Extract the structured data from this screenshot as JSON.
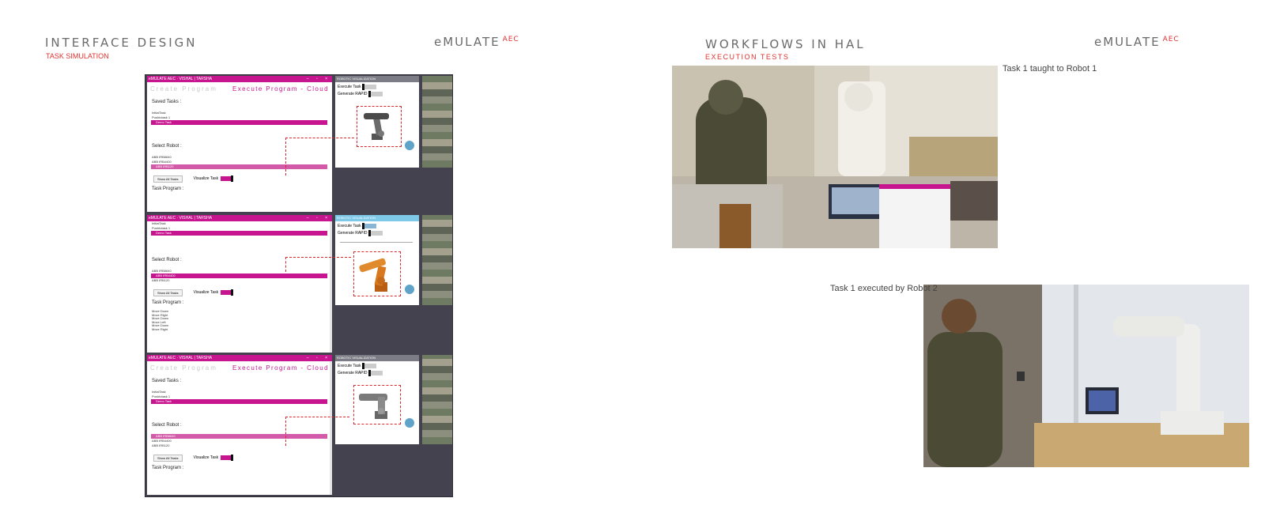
{
  "left_page": {
    "title": "INTERFACE DESIGN",
    "subtitle": "TASK SIMULATION",
    "brand": "eMULATE",
    "brand_sup": "AEC"
  },
  "right_page": {
    "title": "WORKFLOWS IN HAL",
    "subtitle": "EXECUTION TESTS",
    "brand": "eMULATE",
    "brand_sup": "AEC",
    "caption_top": "Task 1 taught to Robot 1",
    "caption_bottom": "Task 1 executed by Robot 2"
  },
  "composite": {
    "window_title": "eMULATE AEC · VISHAL | TARSHA",
    "viz_title": "ROBOTIC VISUALIZATION",
    "tab_create": "Create Program",
    "tab_execute": "Execute Program - Cloud",
    "saved_tasks_label": "Saved Tasks :",
    "select_robot_label": "Select Robot :",
    "task_program_label": "Task Program :",
    "show_all_tasks": "Show All Tasks",
    "visualize_task": "Visualize Task",
    "execute_task": "Execute Task",
    "generate_rapid": "Generate RAPID",
    "tasks": [
      "InitialTask",
      "Pushtotask 1",
      "Demo Task"
    ],
    "robots": [
      "ABB IRB6640",
      "ABB IRB4400",
      "ABB IRB120"
    ],
    "program_lines": [
      "Move Down",
      "Move Right",
      "Move Down",
      "Move Left",
      "Move Down",
      "Move Right",
      "Move Down"
    ]
  },
  "colors": {
    "accent": "#c7158f",
    "red": "#e0312f",
    "panel_dark": "#44424f"
  }
}
